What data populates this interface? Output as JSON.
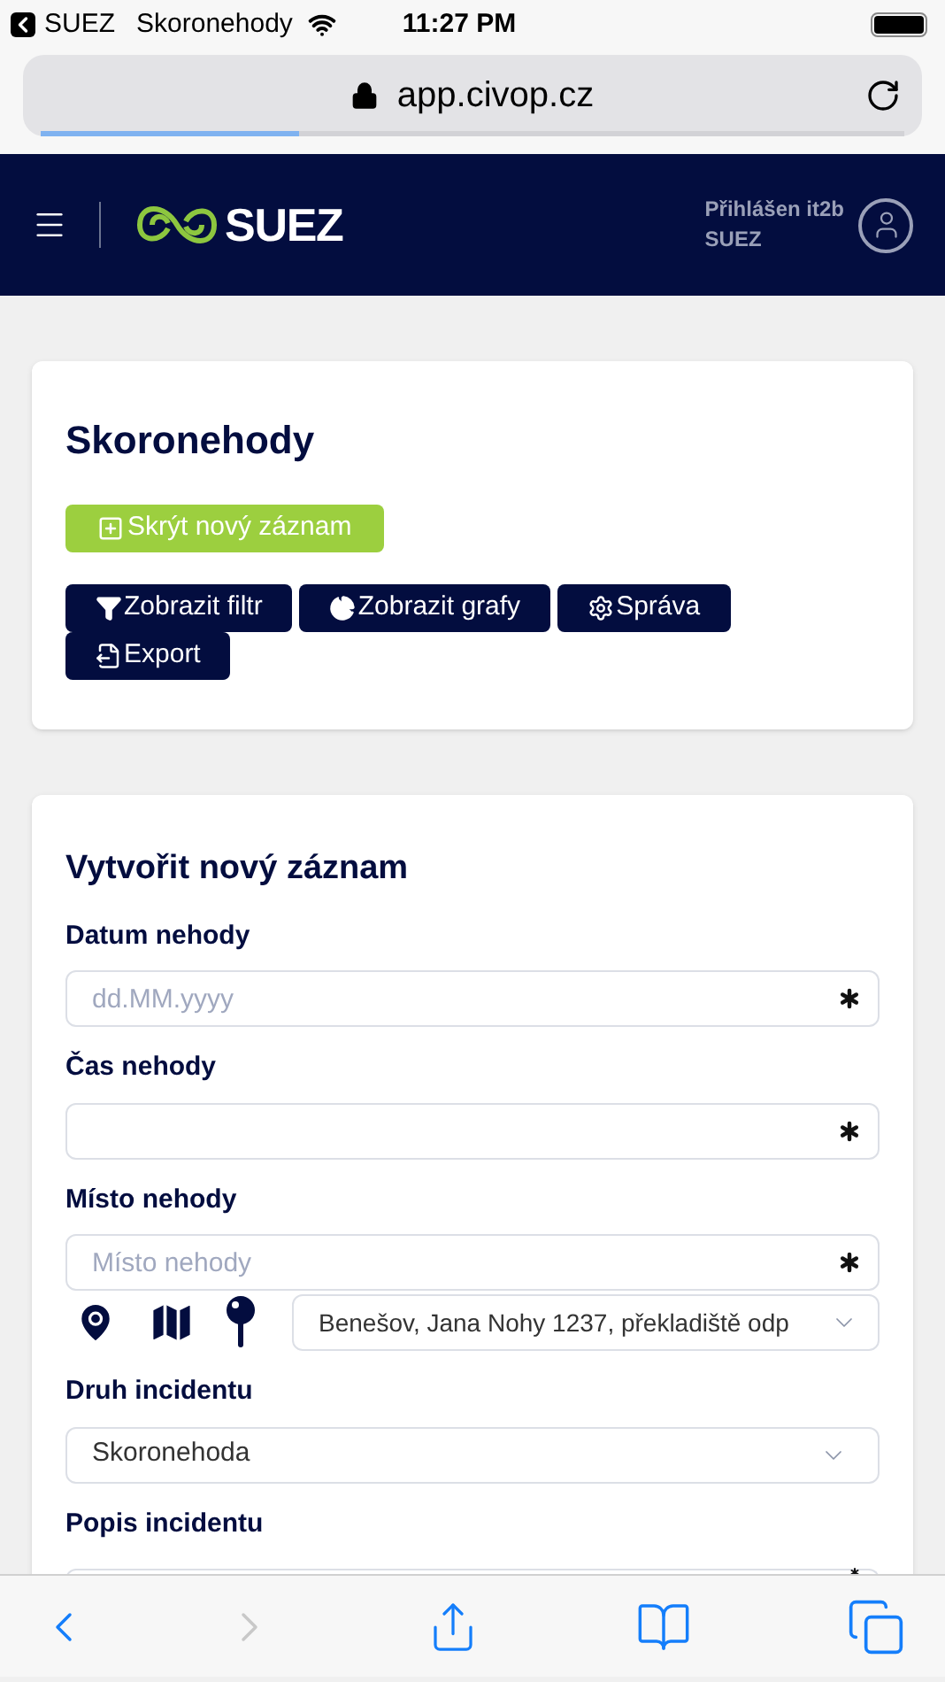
{
  "status_bar": {
    "back_app": "SUEZ",
    "carrier": "Skoronehody",
    "time": "11:27 PM"
  },
  "address_bar": {
    "url": "app.civop.cz",
    "level": 0.3
  },
  "header": {
    "logo_text": "SUEZ",
    "user_line": "Přihlášen it2b",
    "company": "SUEZ"
  },
  "list_card": {
    "title": "Skoronehody",
    "primary_button": "Skrýt nový záznam",
    "buttons": [
      {
        "kind": "filter",
        "label": "Zobrazit filtr"
      },
      {
        "kind": "charts",
        "label": "Zobrazit grafy"
      },
      {
        "kind": "settings",
        "label": "Správa"
      },
      {
        "kind": "export",
        "label": "Export"
      }
    ]
  },
  "form": {
    "title": "Vytvořit nový záznam",
    "fields": [
      {
        "kind": "input",
        "label": "Datum nehody",
        "placeholder": "dd.MM.yyyy",
        "required": true
      },
      {
        "kind": "input",
        "label": "Čas nehody",
        "required": true
      },
      {
        "kind": "input",
        "label": "Místo nehody",
        "placeholder": "Místo nehody",
        "required": true
      },
      {
        "kind": "location",
        "value": "Benešov, Jana Nohy 1237, překladiště odp"
      },
      {
        "kind": "select",
        "label": "Druh incidentu",
        "value": "Skoronehoda"
      },
      {
        "kind": "input",
        "label": "Popis incidentu",
        "required": true
      }
    ]
  },
  "toolbar": {
    "back_disabled": false,
    "forward_disabled": true
  }
}
